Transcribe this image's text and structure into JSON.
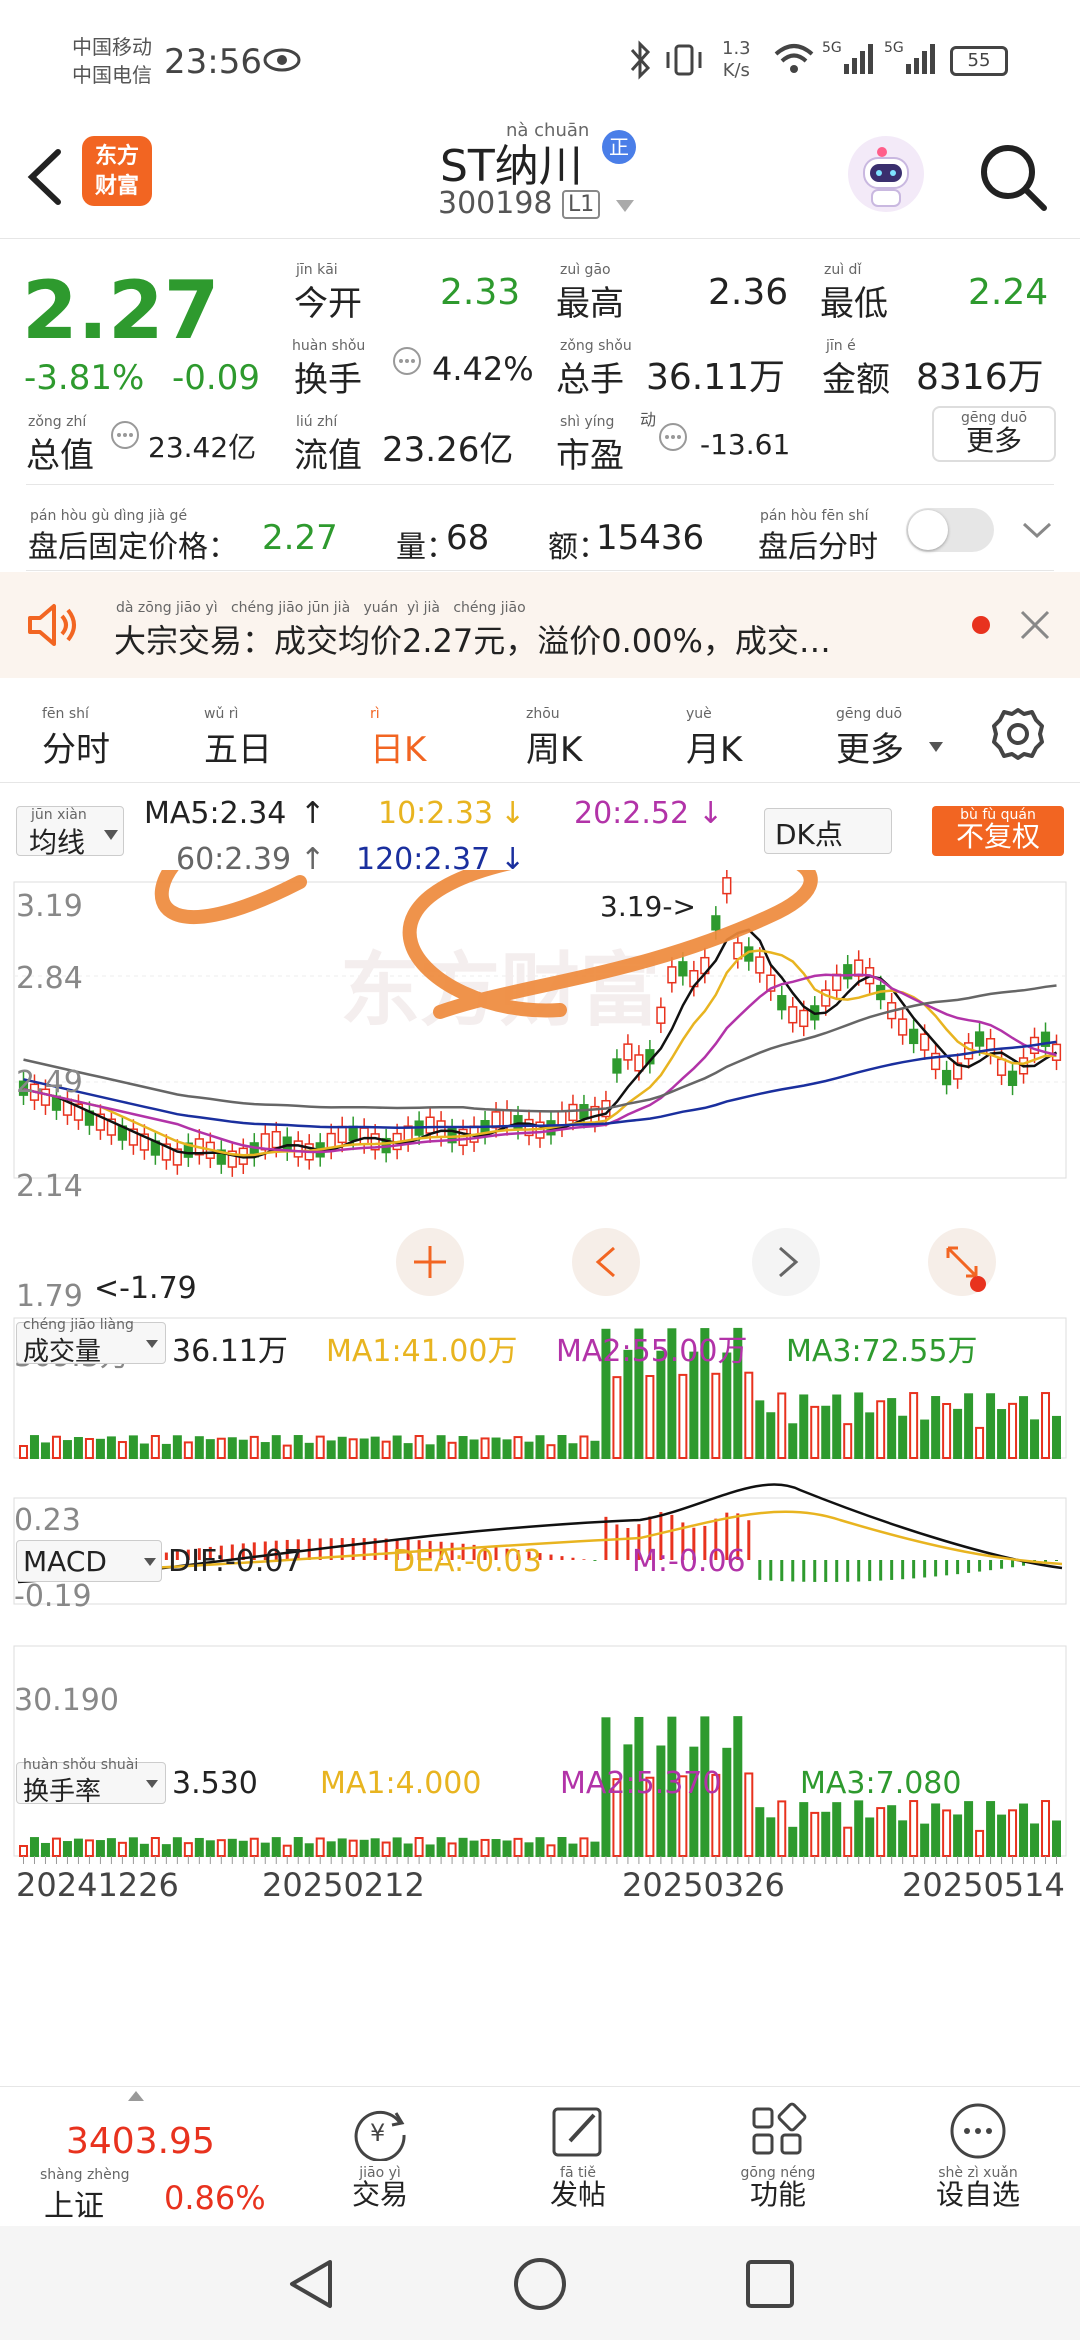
{
  "status_bar": {
    "carrier1": "中国移动",
    "carrier2": "中国电信",
    "time": "23:56",
    "net_speed_value": "1.3",
    "net_speed_unit": "K/s",
    "sig1": "5G",
    "sig2": "5G",
    "battery": "55"
  },
  "header": {
    "logo_line1": "东方",
    "logo_line2": "财富",
    "stock_name": "ST纳川",
    "stock_name_pinyin": "nà chuān",
    "badge": "正",
    "stock_code": "300198",
    "level": "L1"
  },
  "quote": {
    "price": "2.27",
    "change_pct": "-3.81%",
    "change": "-0.09",
    "open_label": "今开",
    "open_pinyin": "jīn kāi",
    "open": "2.33",
    "high_label": "最高",
    "high_pinyin": "zuì gāo",
    "high": "2.36",
    "low_label": "最低",
    "low_pinyin": "zuì dǐ",
    "low": "2.24",
    "turnover_label": "换手",
    "turnover_pinyin": "huàn shǒu",
    "turnover": "4.42%",
    "volume_label": "总手",
    "volume_pinyin": "zǒng shǒu",
    "volume": "36.11万",
    "amount_label": "金额",
    "amount_pinyin": "jīn é",
    "amount": "8316万",
    "mktcap_label": "总值",
    "mktcap_pinyin": "zǒng zhí",
    "mktcap": "23.42亿",
    "float_label": "流值",
    "float_pinyin": "liú zhí",
    "float": "23.26亿",
    "pe_label": "市盈",
    "pe_pinyin": "shì yíng",
    "pe_sub": "动",
    "pe": "-13.61",
    "more_label": "更多",
    "more_pinyin": "gēng duō"
  },
  "after_hours": {
    "fixed_price_label": "盘后固定价格：",
    "fixed_price_pinyin": "pán hòu gù dìng jià gé",
    "fixed_price": "2.27",
    "qty_label": "量：",
    "qty": "68",
    "amount_label": "额：",
    "amount": "15436",
    "timeshare_label": "盘后分时",
    "timeshare_pinyin": "pán hòu fēn shí"
  },
  "notice": {
    "text": "大宗交易：成交均价2.27元，溢价0.00%，成交…",
    "pinyin": "dà zōng jiāo yì   chéng jiāo jūn jià   yuán  yì jià   chéng jiāo"
  },
  "period_tabs": [
    {
      "label": "分时",
      "pinyin": "fēn shí",
      "active": false
    },
    {
      "label": "五日",
      "pinyin": "wǔ rì",
      "active": false
    },
    {
      "label": "日K",
      "pinyin": "rì",
      "active": true
    },
    {
      "label": "周K",
      "pinyin": "zhōu",
      "active": false
    },
    {
      "label": "月K",
      "pinyin": "yuè",
      "active": false
    },
    {
      "label": "更多",
      "pinyin": "gēng duō",
      "active": false
    }
  ],
  "ma_bar": {
    "selector": "均线",
    "selector_pinyin": "jūn xiàn",
    "ma5": "MA5:2.34",
    "ma10": "10:2.33",
    "ma20": "20:2.52",
    "ma60": "60:2.39",
    "ma120": "120:2.37",
    "dk_button": "DK点",
    "adjust_button": "不复权",
    "adjust_pinyin": "bù fù quán"
  },
  "kline": {
    "y_labels": [
      "3.19",
      "2.84",
      "2.49",
      "2.14",
      "1.79"
    ],
    "max_label": "3.19->",
    "min_label": "<-1.79",
    "watermark": "东方财富"
  },
  "volume_panel": {
    "selector": "成交量",
    "selector_pinyin": "chéng jiāo liàng",
    "value": "36.11万",
    "ma1": "MA1:41.00万",
    "ma2": "MA2:55.00万",
    "ma3": "MA3:72.55万",
    "y_label": "309.3万"
  },
  "macd_panel": {
    "selector": "MACD",
    "dif": "DIF:-0.07",
    "dea": "DEA:-0.03",
    "m": "M:-0.06",
    "y_top": "0.23",
    "y_bottom": "-0.19"
  },
  "turnover_panel": {
    "selector": "换手率",
    "selector_pinyin": "huàn shǒu shuài",
    "value": "3.530",
    "ma1": "MA1:4.000",
    "ma2": "MA2:5.370",
    "ma3": "MA3:7.080",
    "y_label": "30.190"
  },
  "dates": [
    "20241226",
    "20250212",
    "20250326",
    "20250514"
  ],
  "bottom_nav": {
    "index_value": "3403.95",
    "index_name": "上证",
    "index_pinyin": "shàng zhèng",
    "index_change": "0.86%",
    "items": [
      {
        "label": "交易",
        "pinyin": "jiāo yì",
        "icon": "yuan-exchange-icon"
      },
      {
        "label": "发帖",
        "pinyin": "fā tiě",
        "icon": "edit-icon"
      },
      {
        "label": "功能",
        "pinyin": "gōng néng",
        "icon": "grid-icon"
      },
      {
        "label": "设自选",
        "pinyin": "shè zì xuǎn",
        "icon": "more-icon"
      }
    ]
  },
  "colors": {
    "up": "#e8321e",
    "down": "#2e9a2e",
    "ma5": "#111111",
    "ma10": "#e8b420",
    "ma20": "#b233a8",
    "ma60": "#666666",
    "ma120": "#1a2f9e",
    "orange": "#f26522",
    "scribble": "#ee8a3c"
  }
}
